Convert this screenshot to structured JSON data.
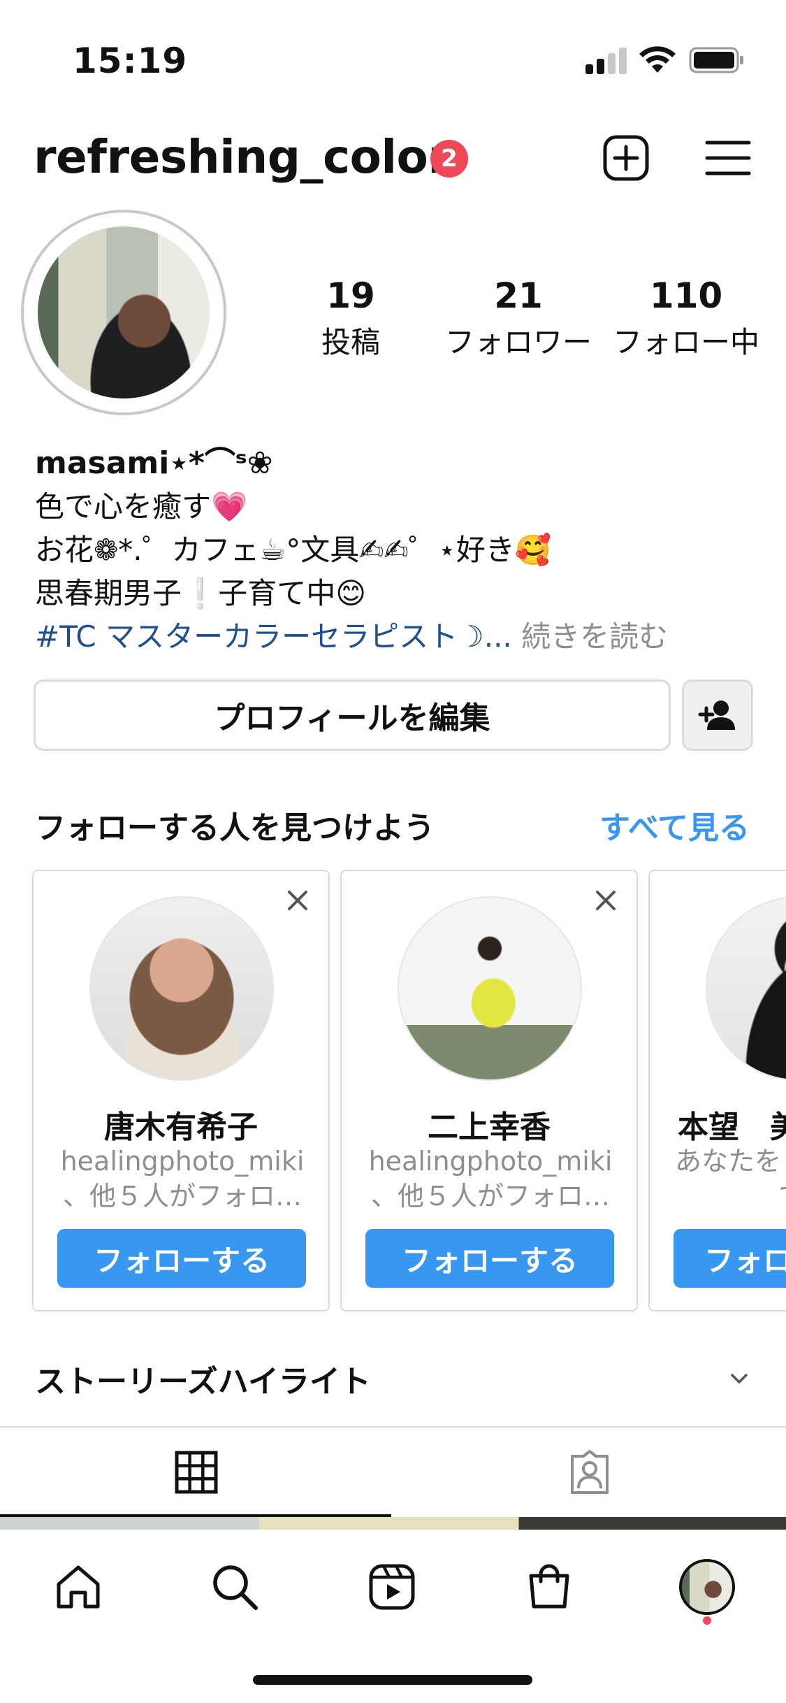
{
  "status_bar": {
    "time": "15:19"
  },
  "header": {
    "username": "refreshing_color",
    "notification_count": "2"
  },
  "stats": [
    {
      "value": "19",
      "label": "投稿"
    },
    {
      "value": "21",
      "label": "フォロワー"
    },
    {
      "value": "110",
      "label": "フォロー中"
    }
  ],
  "bio": {
    "name": "masami⋆*⌒ˢ❀",
    "line1": "色で心を癒す💗",
    "line2": "お花❁*.゜カフェ☕︎°文具✍︎✍︎゜⋆好き🥰",
    "line3": "思春期男子❕子育て中😊",
    "hashtag": "#TC マスターカラーセラピスト☽...",
    "more": " 続きを読む"
  },
  "actions": {
    "edit_profile": "プロフィールを編集"
  },
  "discover": {
    "title": "フォローする人を見つけよう",
    "see_all": "すべて見る",
    "cards": [
      {
        "name": "唐木有希子",
        "sub1": "healingphoto_miki",
        "sub2": "、他５人がフォロ…",
        "button": "フォローする"
      },
      {
        "name": "二上幸香",
        "sub1": "healingphoto_miki",
        "sub2": "、他５人がフォロ…",
        "button": "フォローする"
      },
      {
        "name": "本望　美",
        "sub1": "あなたを",
        "sub2": "て",
        "button": "フォロ"
      }
    ]
  },
  "highlights": {
    "title": "ストーリーズハイライト"
  },
  "colors": {
    "accent": "#3897f0",
    "badge": "#ed4956",
    "hashtag": "#1f4f8c"
  }
}
